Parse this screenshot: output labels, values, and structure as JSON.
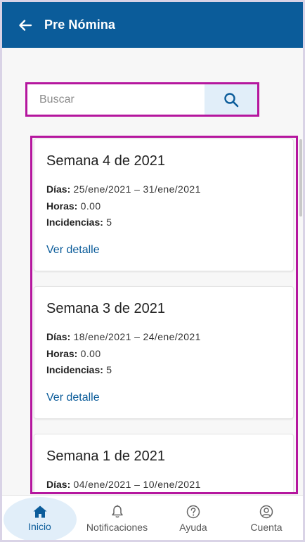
{
  "header": {
    "title": "Pre Nómina",
    "back_icon": "arrow-left-icon"
  },
  "search": {
    "placeholder": "Buscar",
    "value": "",
    "icon": "search-icon"
  },
  "labels": {
    "dias": "Días:",
    "horas": "Horas:",
    "incidencias": "Incidencias:"
  },
  "weeks": [
    {
      "title": "Semana 4 de 2021",
      "dias": "25/ene/2021 – 31/ene/2021",
      "horas": "0.00",
      "incidencias": "5",
      "link": "Ver detalle"
    },
    {
      "title": "Semana 3 de 2021",
      "dias": "18/ene/2021 – 24/ene/2021",
      "horas": "0.00",
      "incidencias": "5",
      "link": "Ver detalle"
    },
    {
      "title": "Semana 1 de 2021",
      "dias": "04/ene/2021 – 10/ene/2021"
    }
  ],
  "bottom_nav": [
    {
      "label": "Inicio",
      "icon": "home-icon",
      "active": true
    },
    {
      "label": "Notificaciones",
      "icon": "bell-icon"
    },
    {
      "label": "Ayuda",
      "icon": "help-icon"
    },
    {
      "label": "Cuenta",
      "icon": "account-icon"
    }
  ],
  "colors": {
    "primary": "#0b5c9a",
    "highlight": "#b5169e",
    "active_bg": "#e1eef9"
  }
}
